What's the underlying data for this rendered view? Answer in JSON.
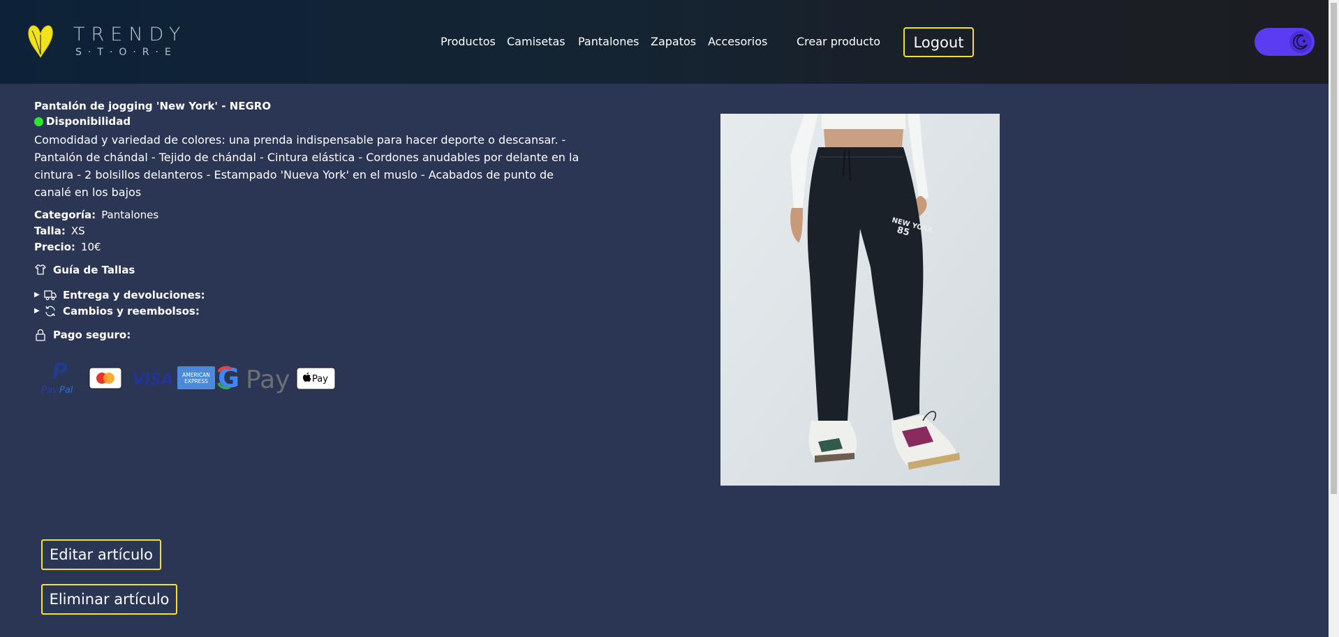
{
  "header": {
    "logo_line1": "TRENDY",
    "logo_line2": "S·T·O·R·E",
    "nav": [
      {
        "label": "Productos"
      },
      {
        "label": "Camisetas"
      },
      {
        "label": "Pantalones"
      },
      {
        "label": "Zapatos"
      },
      {
        "label": "Accesorios"
      },
      {
        "label": "Crear producto"
      }
    ],
    "logout_label": "Logout",
    "theme_toggle_icon": "moon-icon",
    "accent_color": "#f4e22a",
    "toggle_color": "#5c3cf0"
  },
  "product": {
    "title": "Pantalón de jogging 'New York' - NEGRO",
    "availability": "Disponibilidad",
    "availability_color": "#2ee62e",
    "description": "Comodidad y variedad de colores: una prenda indispensable para hacer deporte o descansar. - Pantalón de chándal - Tejido de chándal - Cintura elástica - Cordones anudables por delante en la cintura - 2 bolsillos delanteros - Estampado 'Nueva York' en el muslo - Acabados de punto de canalé en los bajos",
    "specs": {
      "category_label": "Categoría:",
      "category_value": "Pantalones",
      "size_label": "Talla:",
      "size_value": "XS",
      "price_label": "Precio:",
      "price_value": "10€"
    },
    "size_guide": "Guía de Tallas",
    "delivery": "Entrega y devoluciones:",
    "exchanges": "Cambios y reembolsos:",
    "secure_payment": "Pago seguro:",
    "payment_methods": [
      "PayPal",
      "Mastercard",
      "VISA",
      "American Express",
      "G Pay",
      "Apple Pay"
    ],
    "image_print_text": "NEW YORK 85"
  },
  "actions": {
    "edit_label": "Editar artículo",
    "delete_label": "Eliminar artículo"
  }
}
